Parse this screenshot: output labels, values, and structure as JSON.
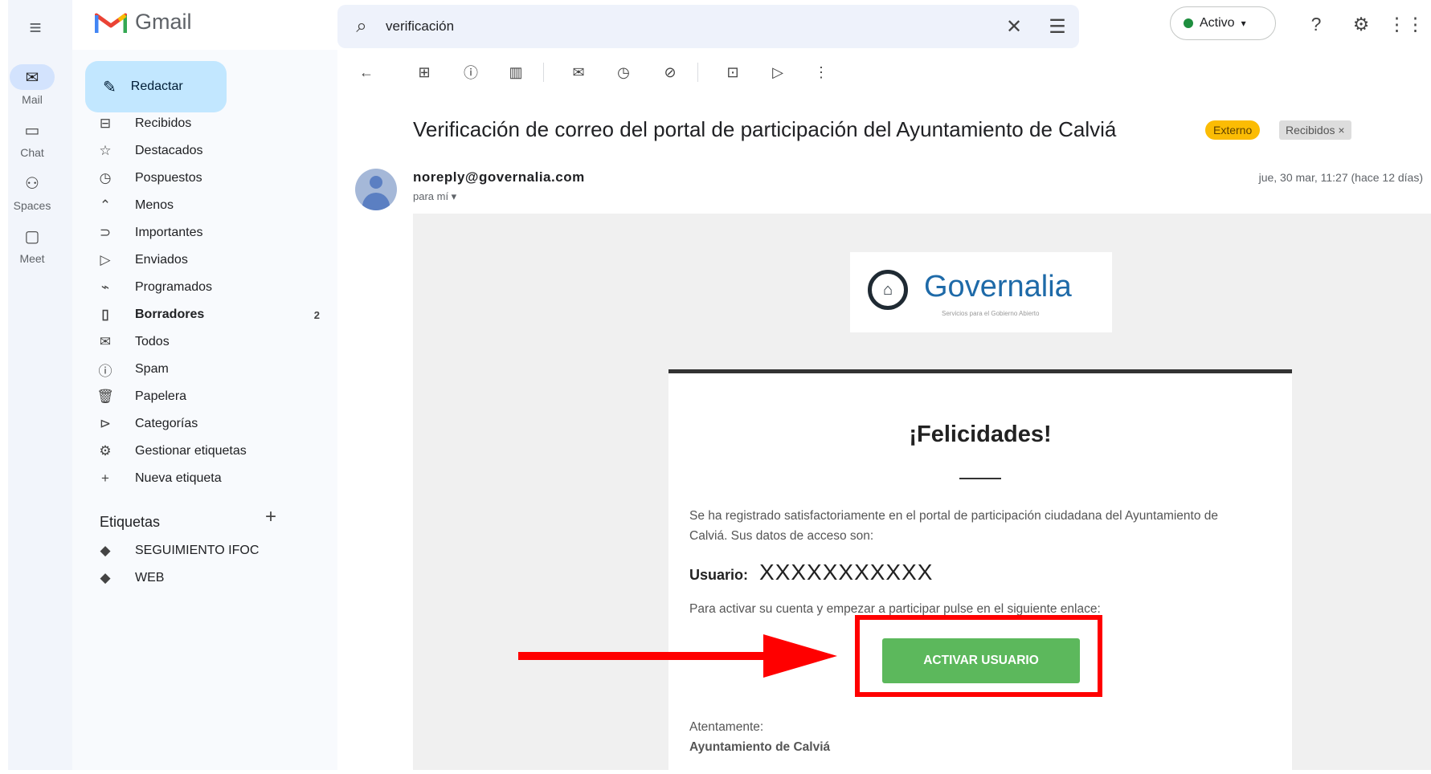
{
  "app": {
    "name": "Gmail"
  },
  "rail": [
    {
      "label": "Mail",
      "icon": "mail-icon",
      "glyph": "✉"
    },
    {
      "label": "Chat",
      "icon": "chat-icon",
      "glyph": "▭"
    },
    {
      "label": "Spaces",
      "icon": "spaces-icon",
      "glyph": "⚇"
    },
    {
      "label": "Meet",
      "icon": "meet-icon",
      "glyph": "▢"
    }
  ],
  "compose": {
    "label": "Redactar"
  },
  "nav": [
    {
      "label": "Recibidos",
      "icon": "inbox-icon",
      "glyph": "⊟"
    },
    {
      "label": "Destacados",
      "icon": "star-icon",
      "glyph": "☆"
    },
    {
      "label": "Pospuestos",
      "icon": "clock-icon",
      "glyph": "◷"
    },
    {
      "label": "Menos",
      "icon": "chevron-up-icon",
      "glyph": "⌃"
    },
    {
      "label": "Importantes",
      "icon": "important-icon",
      "glyph": "⊃"
    },
    {
      "label": "Enviados",
      "icon": "send-icon",
      "glyph": "▷"
    },
    {
      "label": "Programados",
      "icon": "scheduled-icon",
      "glyph": "⌁"
    },
    {
      "label": "Borradores",
      "icon": "draft-icon",
      "glyph": "▯",
      "count": "2"
    },
    {
      "label": "Todos",
      "icon": "all-mail-icon",
      "glyph": "✉"
    },
    {
      "label": "Spam",
      "icon": "spam-icon",
      "glyph": "ⓘ"
    },
    {
      "label": "Papelera",
      "icon": "trash-icon",
      "glyph": "🗑"
    },
    {
      "label": "Categorías",
      "icon": "label-icon",
      "glyph": "⊳"
    },
    {
      "label": "Gestionar etiquetas",
      "icon": "gear-icon",
      "glyph": "⚙"
    },
    {
      "label": "Nueva etiqueta",
      "icon": "plus-icon",
      "glyph": "+"
    }
  ],
  "labels_section": {
    "title": "Etiquetas",
    "items": [
      {
        "label": "SEGUIMIENTO IFOC"
      },
      {
        "label": "WEB"
      }
    ]
  },
  "search": {
    "value": "verificación"
  },
  "status": {
    "label": "Activo"
  },
  "email": {
    "subject": "Verificación de correo del portal de participación del Ayuntamiento de Calviá",
    "badges": {
      "external": "Externo",
      "inbox": "Recibidos ×"
    },
    "sender": "noreply@governalia.com",
    "to": "para mí ▾",
    "date": "jue, 30 mar, 11:27 (hace 12 días)"
  },
  "governalia": {
    "name": "Governalia",
    "tagline": "Servicios para el Gobierno Abierto"
  },
  "body": {
    "title": "¡Felicidades!",
    "text1": "Se ha registrado satisfactoriamente en el portal de participación ciudadana del Ayuntamiento de Calviá. Sus datos de acceso son:",
    "user_label": "Usuario:",
    "user_value": "XXXXXXXXXXX",
    "text2": "Para activar su cuenta y empezar a participar pulse en el siguiente enlace:",
    "button": "ACTIVAR USUARIO",
    "sign1": "Atentamente:",
    "sign2": "Ayuntamiento de Calviá"
  },
  "colors": {
    "compose_bg": "#c2e7ff",
    "external_badge": "#fbbc04",
    "activate_button": "#5cb85c",
    "annotation": "#ff0000",
    "brand_blue": "#1e6aa8"
  }
}
